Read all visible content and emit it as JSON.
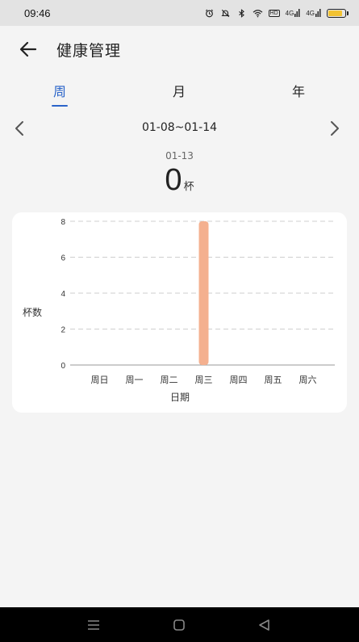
{
  "status_bar": {
    "time": "09:46",
    "icons": [
      "alarm-icon",
      "mute-icon",
      "bluetooth-icon",
      "wifi-icon",
      "hd-icon",
      "signal-4g-icon",
      "signal-4g-icon",
      "battery-icon"
    ],
    "hd_label": "HD",
    "net_label_1": "4G",
    "net_label_2": "4G",
    "battery_level": 0.85
  },
  "app_bar": {
    "back_icon": "back-arrow-icon",
    "title": "健康管理"
  },
  "tabs": [
    {
      "label": "周",
      "active": true
    },
    {
      "label": "月",
      "active": false
    },
    {
      "label": "年",
      "active": false
    }
  ],
  "date_range": {
    "label": "01-08~01-14",
    "prev_icon": "chevron-left-icon",
    "next_icon": "chevron-right-icon"
  },
  "selected": {
    "date": "01-13",
    "value": "0",
    "unit": "杯"
  },
  "chart_data": {
    "type": "bar",
    "categories": [
      "周日",
      "周一",
      "周二",
      "周三",
      "周四",
      "周五",
      "周六"
    ],
    "values": [
      0,
      0,
      0,
      8,
      0,
      0,
      0
    ],
    "xlabel": "日期",
    "ylabel": "杯数",
    "ylim": [
      0,
      8
    ],
    "yticks": [
      "0",
      "2",
      "4",
      "6",
      "8"
    ],
    "grid": true,
    "bar_color": "#f4b08f"
  },
  "colors": {
    "accent": "#2a64c9",
    "bar": "#f4b08f"
  },
  "nav_bar": {
    "icons": [
      "menu-icon",
      "home-icon",
      "back-icon"
    ]
  }
}
